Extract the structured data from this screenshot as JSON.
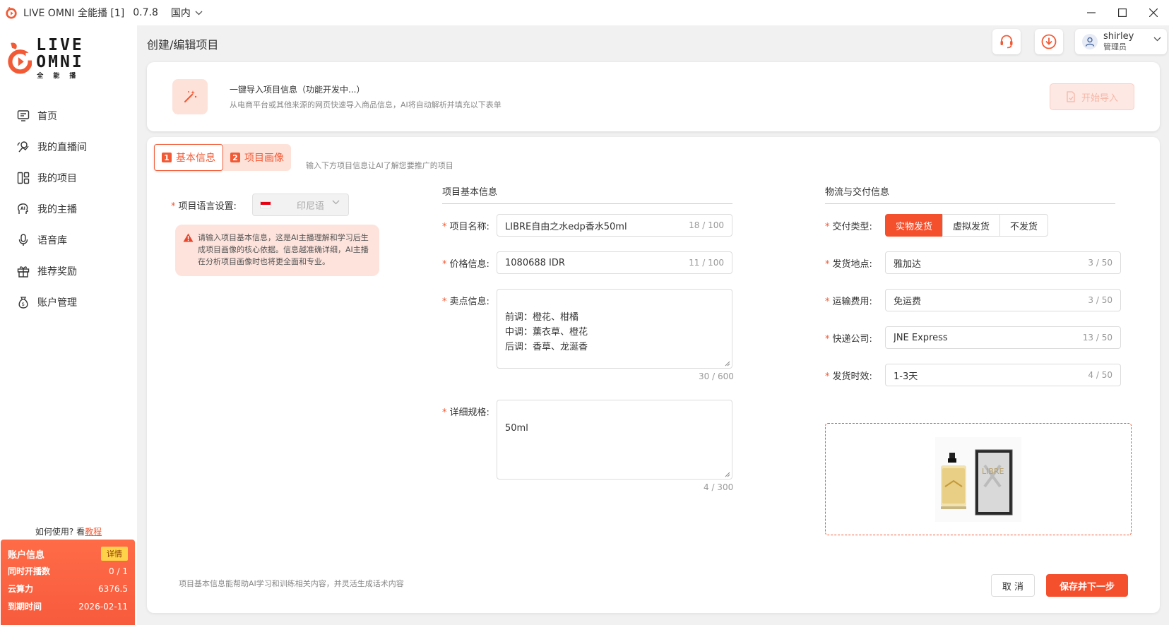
{
  "window": {
    "title": "LIVE OMNI 全能播 [1]",
    "version": "0.7.8",
    "region": "国内"
  },
  "logo": {
    "main": "LIVE OMNI",
    "sub": "全能播"
  },
  "sidebar": {
    "items": [
      {
        "label": "首页",
        "icon": "home-icon"
      },
      {
        "label": "我的直播间",
        "icon": "live-room-icon"
      },
      {
        "label": "我的项目",
        "icon": "grid-icon"
      },
      {
        "label": "我的主播",
        "icon": "ai-host-icon"
      },
      {
        "label": "语音库",
        "icon": "microphone-icon"
      },
      {
        "label": "推荐奖励",
        "icon": "gift-icon"
      },
      {
        "label": "账户管理",
        "icon": "money-bag-icon"
      }
    ],
    "help_prefix": "如何使用? 看",
    "help_link": "教程"
  },
  "account": {
    "title": "账户信息",
    "detail_label": "详情",
    "rows": [
      {
        "label": "同时开播数",
        "value": "0 / 1"
      },
      {
        "label": "云算力",
        "value": "6376.5"
      },
      {
        "label": "到期时间",
        "value": "2026-02-11"
      }
    ]
  },
  "header": {
    "page_title": "创建/编辑项目",
    "user_name": "shirley",
    "user_role": "管理员"
  },
  "import": {
    "title": "一键导入项目信息（功能开发中...）",
    "desc": "从电商平台或其他来源的网页快速导入商品信息，AI将自动解析并填充以下表单",
    "button": "开始导入"
  },
  "tabs": [
    {
      "num": "1",
      "label": "基本信息"
    },
    {
      "num": "2",
      "label": "项目画像"
    }
  ],
  "tab_hint": "输入下方项目信息让AI了解您要推广的项目",
  "lang": {
    "label": "项目语言设置",
    "value": "印尼语"
  },
  "warning_text": "请输入项目基本信息，这是AI主播理解和学习后生成项目画像的核心依据。信息越准确详细，AI主播在分析项目画像时也将更全面和专业。",
  "basic": {
    "section_title": "项目基本信息",
    "name_label": "项目名称",
    "name_value": "LIBRE自由之水edp香水50ml",
    "name_count": "18 / 100",
    "price_label": "价格信息",
    "price_value": "1080688 IDR",
    "price_count": "11 / 100",
    "selling_label": "卖点信息",
    "selling_value": "前调：橙花、柑橘\n中调：薰衣草、橙花\n后调：香草、龙涎香",
    "selling_count": "30 / 600",
    "spec_label": "详细规格",
    "spec_value": "50ml",
    "spec_count": "4 / 300"
  },
  "logistics": {
    "section_title": "物流与交付信息",
    "delivery_label": "交付类型",
    "delivery_options": [
      "实物发货",
      "虚拟发货",
      "不发货"
    ],
    "delivery_selected": "实物发货",
    "origin_label": "发货地点",
    "origin_value": "雅加达",
    "origin_count": "3 / 50",
    "fee_label": "运输费用",
    "fee_value": "免运费",
    "fee_count": "3 / 50",
    "courier_label": "快递公司",
    "courier_value": "JNE Express",
    "courier_count": "13 / 50",
    "time_label": "发货时效",
    "time_value": "1-3天",
    "time_count": "4 / 50"
  },
  "footer": {
    "note": "项目基本信息能帮助AI学习和训练相关内容，并灵活生成话术内容",
    "cancel": "取 消",
    "save": "保存并下一步"
  },
  "colors": {
    "accent": "#f5502e",
    "accent_light": "#fde2da",
    "warning_bg": "#fde3dc",
    "account_card": "#ff6b47"
  }
}
